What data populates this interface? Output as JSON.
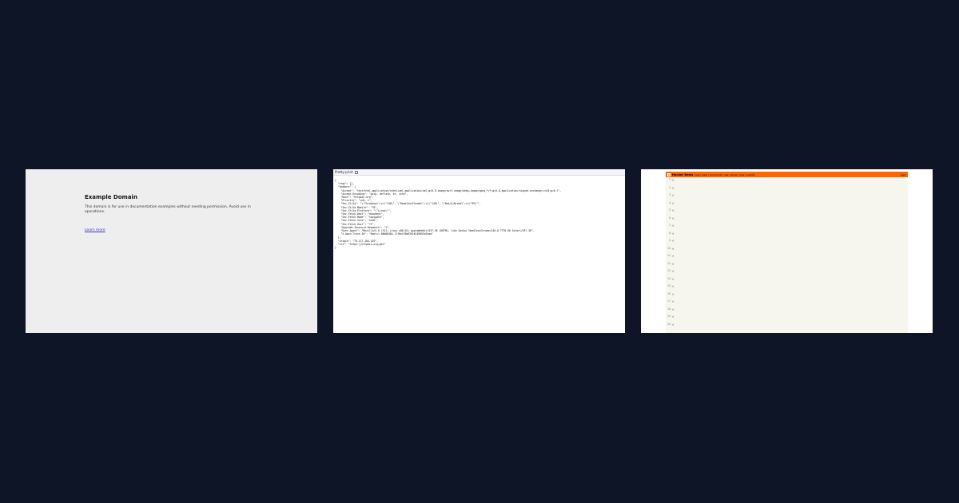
{
  "example": {
    "title": "Example Domain",
    "body": "This domain is for use in documentation examples without needing permission. Avoid use in operations.",
    "link": "Learn more"
  },
  "json_viewer": {
    "pretty_print_label": "Pretty-print",
    "content": "{\n  \"args\": {},\n  \"headers\": {\n    \"Accept\": \"text/html,application/xhtml+xml,application/xml;q=0.9,image/avif,image/webp,image/apng,*/*;q=0.8,application/signed-exchange;v=b3;q=0.7\",\n    \"Accept-Encoding\": \"gzip, deflate, br, zstd\",\n    \"Host\": \"httpbin.org\",\n    \"Priority\": \"u=0, i\",\n    \"Sec-Ch-Ua\": \"\\\"Chromium\\\";v=\\\"140\\\", \\\"HeadlessChrome\\\";v=\\\"140\\\", \\\"Not/A)Brand\\\";v=\\\"99\\\"\",\n    \"Sec-Ch-Ua-Mobile\": \"?0\",\n    \"Sec-Ch-Ua-Platform\": \"\\\"Linux\\\"\",\n    \"Sec-Fetch-Dest\": \"document\",\n    \"Sec-Fetch-Mode\": \"navigate\",\n    \"Sec-Fetch-Site\": \"none\",\n    \"Sec-Fetch-User\": \"?1\",\n    \"Upgrade-Insecure-Requests\": \"1\",\n    \"User-Agent\": \"Mozilla/5.0 (X11; Linux x86_64) AppleWebKit/537.36 (KHTML, like Gecko) HeadlessChrome/140.0.7778.96 Safari/537.36\",\n    \"X-Amzn-Trace-Id\": \"Root=1-68d0b364-17f6e1f0b63916149055d1eaa\"\n  },\n  \"origin\": \"79.117.184.107\",\n  \"url\": \"https://httpbin.org/get\"\n}"
  },
  "hn": {
    "logo": "Y",
    "name": "Hacker News",
    "nav": "new | past | comments | ask | show | jobs | submit",
    "login": "login",
    "items": [
      {
        "rank": "1.",
        "title": "Map of Metal",
        "site": "(mapofmetal.com)",
        "sub": "64 points by emitter 3 hours ago | hide | 16 comments"
      },
      {
        "rank": "2.",
        "title": "Everything in C is undefined behavior",
        "site": "(lapcatsoft.com)",
        "sub": "212 points by ingve 6 hours ago | hide | 287 comments"
      },
      {
        "rank": "3.",
        "title": "Qwen3.7 Max: The Agent Frontier",
        "site": "(qwen.ai)",
        "sub": "184 points by tosh 5 hours ago | hide | 92 comments"
      },
      {
        "rank": "4.",
        "title": "College students drown out AI-praising commencement speeches with boos",
        "site": "(businessinsider.com)",
        "sub": "312 points by pseudolus 7 hours ago | hide | 241 comments"
      },
      {
        "rank": "5.",
        "title": "Nobody understands the point of hybrid cars (video)",
        "site": "(youtube.com)",
        "sub": "98 points by surprisetalk 4 hours ago | hide | 173 comments"
      },
      {
        "rank": "6.",
        "title": "Gemini 3.5 Flash",
        "site": "(blog.google)",
        "sub": "276 points by meetpateltech 8 hours ago | hide | 134 comments"
      },
      {
        "rank": "7.",
        "title": "FiveThirtyEight articles on the Internet Archive",
        "site": "(archive.org)",
        "sub": "143 points by jwilber 6 hours ago | hide | 38 comments"
      },
      {
        "rank": "8.",
        "title": "I've built a virtual museum with nearly every operating system you can think of",
        "site": "(pcmuseum.org)",
        "sub": "501 points by voxadam 10 hours ago | hide | 119 comments"
      },
      {
        "rank": "9.",
        "title": "Japan is gripped by mass allergies: A 1950s project is to blame",
        "site": "(bbc.com)",
        "sub": "88 points by rbanffy 5 hours ago | hide | 67 comments"
      },
      {
        "rank": "10.",
        "title": "Anna's Archive Hit with $18.9M Default Judgment and Global Domain Takedown Order",
        "site": "(torrentfreak.com)",
        "sub": "233 points by BlackGlory 9 hours ago | hide | 196 comments"
      },
      {
        "rank": "11.",
        "title": "Google's AI is being manipulated. The search giant is quietly fighting back",
        "site": "(bbc.com)",
        "sub": "121 points by mitchbob 7 hours ago | hide | 88 comments"
      },
      {
        "rank": "12.",
        "title": "Saying Goodbye to Asm.js",
        "site": "(spidermonkey.dev)",
        "sub": "67 points by lazzlazzlazz 4 hours ago | hide | 21 comments"
      },
      {
        "rank": "13.",
        "title": "Infomaniak transitions to a foundation model to protect user data privacy",
        "site": "(infomaniak.com)",
        "sub": "156 points by doener 6 hours ago | hide | 54 comments"
      },
      {
        "rank": "14.",
        "title": "Learnings from 100K lines of Rust with AI (2025)",
        "site": "(frommyfig.github.io)",
        "sub": "192 points by philbo 9 hours ago | hide | 143 comments"
      },
      {
        "rank": "15.",
        "title": "Google changes its search box",
        "site": "(blog.google)",
        "sub": "247 points by iamflimflam1 8 hours ago | hide | 302 comments"
      },
      {
        "rank": "16.",
        "title": "Show HN: Forge – Guardrails take an 8B model from 53% to 99% on agentic tasks",
        "site": "(github.com/antoinezambelli)",
        "sub": "107 points by zambelli 5 hours ago | hide | 41 comments"
      },
      {
        "rank": "17.",
        "title": "Remove-AI-Watermarks – CLI and library for removing AI watermarks from images",
        "site": "(github.com/wiltodelta)",
        "sub": "89 points by wiltodelta 4 hours ago | hide | 62 comments"
      },
      {
        "rank": "18.",
        "title": "The invention of Books",
        "site": "(aeon.co)",
        "sub": "54 points by Tomte 3 hours ago | hide | 19 comments"
      },
      {
        "rank": "19.",
        "title": "Apple unveils new accessibility features",
        "site": "(apple.com)",
        "sub": "178 points by gnabgib 7 hours ago | hide | 76 comments"
      },
      {
        "rank": "20.",
        "title": "OpenAI Adopts Google's SynthID Watermark for AI Images with Verification Tool",
        "site": "(opnal.com)",
        "sub": "134 points by hn_acker 6 hours ago | hide | 58 comments"
      }
    ]
  }
}
